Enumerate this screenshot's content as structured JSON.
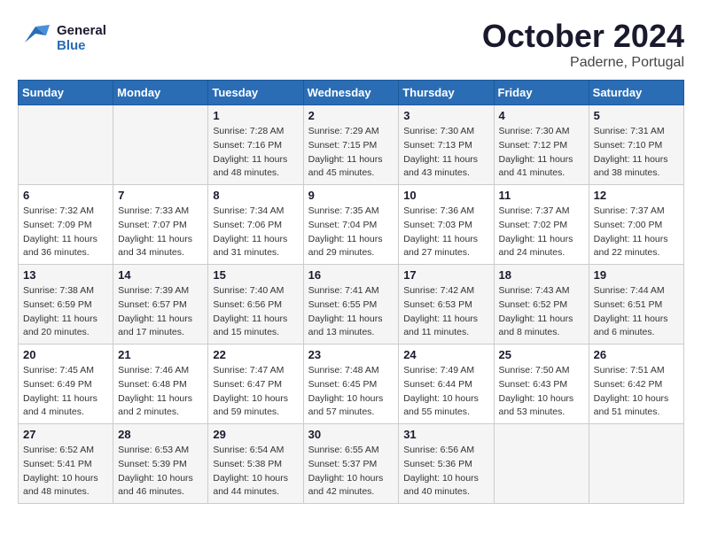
{
  "header": {
    "logo_general": "General",
    "logo_blue": "Blue",
    "month": "October 2024",
    "location": "Paderne, Portugal"
  },
  "weekdays": [
    "Sunday",
    "Monday",
    "Tuesday",
    "Wednesday",
    "Thursday",
    "Friday",
    "Saturday"
  ],
  "weeks": [
    [
      {
        "day": "",
        "sunrise": "",
        "sunset": "",
        "daylight": ""
      },
      {
        "day": "",
        "sunrise": "",
        "sunset": "",
        "daylight": ""
      },
      {
        "day": "1",
        "sunrise": "Sunrise: 7:28 AM",
        "sunset": "Sunset: 7:16 PM",
        "daylight": "Daylight: 11 hours and 48 minutes."
      },
      {
        "day": "2",
        "sunrise": "Sunrise: 7:29 AM",
        "sunset": "Sunset: 7:15 PM",
        "daylight": "Daylight: 11 hours and 45 minutes."
      },
      {
        "day": "3",
        "sunrise": "Sunrise: 7:30 AM",
        "sunset": "Sunset: 7:13 PM",
        "daylight": "Daylight: 11 hours and 43 minutes."
      },
      {
        "day": "4",
        "sunrise": "Sunrise: 7:30 AM",
        "sunset": "Sunset: 7:12 PM",
        "daylight": "Daylight: 11 hours and 41 minutes."
      },
      {
        "day": "5",
        "sunrise": "Sunrise: 7:31 AM",
        "sunset": "Sunset: 7:10 PM",
        "daylight": "Daylight: 11 hours and 38 minutes."
      }
    ],
    [
      {
        "day": "6",
        "sunrise": "Sunrise: 7:32 AM",
        "sunset": "Sunset: 7:09 PM",
        "daylight": "Daylight: 11 hours and 36 minutes."
      },
      {
        "day": "7",
        "sunrise": "Sunrise: 7:33 AM",
        "sunset": "Sunset: 7:07 PM",
        "daylight": "Daylight: 11 hours and 34 minutes."
      },
      {
        "day": "8",
        "sunrise": "Sunrise: 7:34 AM",
        "sunset": "Sunset: 7:06 PM",
        "daylight": "Daylight: 11 hours and 31 minutes."
      },
      {
        "day": "9",
        "sunrise": "Sunrise: 7:35 AM",
        "sunset": "Sunset: 7:04 PM",
        "daylight": "Daylight: 11 hours and 29 minutes."
      },
      {
        "day": "10",
        "sunrise": "Sunrise: 7:36 AM",
        "sunset": "Sunset: 7:03 PM",
        "daylight": "Daylight: 11 hours and 27 minutes."
      },
      {
        "day": "11",
        "sunrise": "Sunrise: 7:37 AM",
        "sunset": "Sunset: 7:02 PM",
        "daylight": "Daylight: 11 hours and 24 minutes."
      },
      {
        "day": "12",
        "sunrise": "Sunrise: 7:37 AM",
        "sunset": "Sunset: 7:00 PM",
        "daylight": "Daylight: 11 hours and 22 minutes."
      }
    ],
    [
      {
        "day": "13",
        "sunrise": "Sunrise: 7:38 AM",
        "sunset": "Sunset: 6:59 PM",
        "daylight": "Daylight: 11 hours and 20 minutes."
      },
      {
        "day": "14",
        "sunrise": "Sunrise: 7:39 AM",
        "sunset": "Sunset: 6:57 PM",
        "daylight": "Daylight: 11 hours and 17 minutes."
      },
      {
        "day": "15",
        "sunrise": "Sunrise: 7:40 AM",
        "sunset": "Sunset: 6:56 PM",
        "daylight": "Daylight: 11 hours and 15 minutes."
      },
      {
        "day": "16",
        "sunrise": "Sunrise: 7:41 AM",
        "sunset": "Sunset: 6:55 PM",
        "daylight": "Daylight: 11 hours and 13 minutes."
      },
      {
        "day": "17",
        "sunrise": "Sunrise: 7:42 AM",
        "sunset": "Sunset: 6:53 PM",
        "daylight": "Daylight: 11 hours and 11 minutes."
      },
      {
        "day": "18",
        "sunrise": "Sunrise: 7:43 AM",
        "sunset": "Sunset: 6:52 PM",
        "daylight": "Daylight: 11 hours and 8 minutes."
      },
      {
        "day": "19",
        "sunrise": "Sunrise: 7:44 AM",
        "sunset": "Sunset: 6:51 PM",
        "daylight": "Daylight: 11 hours and 6 minutes."
      }
    ],
    [
      {
        "day": "20",
        "sunrise": "Sunrise: 7:45 AM",
        "sunset": "Sunset: 6:49 PM",
        "daylight": "Daylight: 11 hours and 4 minutes."
      },
      {
        "day": "21",
        "sunrise": "Sunrise: 7:46 AM",
        "sunset": "Sunset: 6:48 PM",
        "daylight": "Daylight: 11 hours and 2 minutes."
      },
      {
        "day": "22",
        "sunrise": "Sunrise: 7:47 AM",
        "sunset": "Sunset: 6:47 PM",
        "daylight": "Daylight: 10 hours and 59 minutes."
      },
      {
        "day": "23",
        "sunrise": "Sunrise: 7:48 AM",
        "sunset": "Sunset: 6:45 PM",
        "daylight": "Daylight: 10 hours and 57 minutes."
      },
      {
        "day": "24",
        "sunrise": "Sunrise: 7:49 AM",
        "sunset": "Sunset: 6:44 PM",
        "daylight": "Daylight: 10 hours and 55 minutes."
      },
      {
        "day": "25",
        "sunrise": "Sunrise: 7:50 AM",
        "sunset": "Sunset: 6:43 PM",
        "daylight": "Daylight: 10 hours and 53 minutes."
      },
      {
        "day": "26",
        "sunrise": "Sunrise: 7:51 AM",
        "sunset": "Sunset: 6:42 PM",
        "daylight": "Daylight: 10 hours and 51 minutes."
      }
    ],
    [
      {
        "day": "27",
        "sunrise": "Sunrise: 6:52 AM",
        "sunset": "Sunset: 5:41 PM",
        "daylight": "Daylight: 10 hours and 48 minutes."
      },
      {
        "day": "28",
        "sunrise": "Sunrise: 6:53 AM",
        "sunset": "Sunset: 5:39 PM",
        "daylight": "Daylight: 10 hours and 46 minutes."
      },
      {
        "day": "29",
        "sunrise": "Sunrise: 6:54 AM",
        "sunset": "Sunset: 5:38 PM",
        "daylight": "Daylight: 10 hours and 44 minutes."
      },
      {
        "day": "30",
        "sunrise": "Sunrise: 6:55 AM",
        "sunset": "Sunset: 5:37 PM",
        "daylight": "Daylight: 10 hours and 42 minutes."
      },
      {
        "day": "31",
        "sunrise": "Sunrise: 6:56 AM",
        "sunset": "Sunset: 5:36 PM",
        "daylight": "Daylight: 10 hours and 40 minutes."
      },
      {
        "day": "",
        "sunrise": "",
        "sunset": "",
        "daylight": ""
      },
      {
        "day": "",
        "sunrise": "",
        "sunset": "",
        "daylight": ""
      }
    ]
  ]
}
